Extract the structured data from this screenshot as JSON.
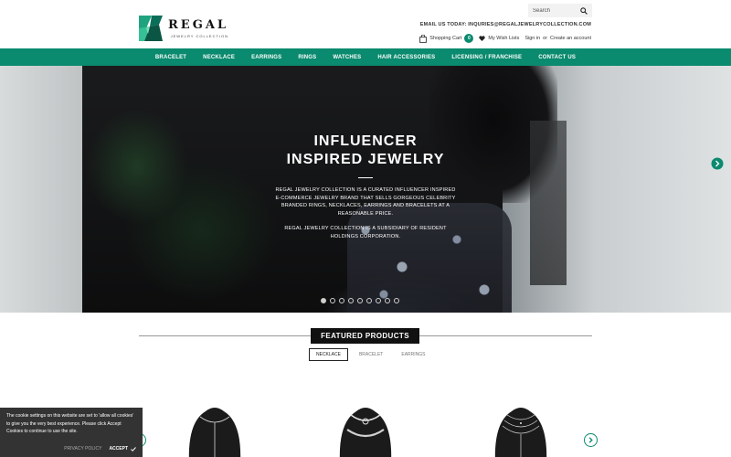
{
  "header": {
    "logo": {
      "name": "REGAL",
      "tagline": "JEWELRY COLLECTION"
    },
    "search": {
      "placeholder": "Search",
      "icon": "search-icon"
    },
    "email_line": "EMAIL US TODAY: INQURIES@REGALJEWELRYCOLLECTION.COM",
    "cart": {
      "label": "Shopping Cart",
      "count": "0",
      "icon": "shopping-bag-icon"
    },
    "wishlist": {
      "label": "My Wish Lists",
      "icon": "heart-icon"
    },
    "signin": "Sign in",
    "or": "or",
    "create_account": "Create an account"
  },
  "nav": {
    "items": [
      "Bracelet",
      "Necklace",
      "Earrings",
      "Rings",
      "Watches",
      "Hair Accessories",
      "Licensing / Franchise",
      "Contact Us"
    ]
  },
  "hero": {
    "title_line1": "INFLUENCER",
    "title_line2": "INSPIRED JEWELRY",
    "text1": "REGAL JEWELRY COLLECTION IS A CURATED INFLUENCER INSPIRED E-COMMERCE JEWELRY BRAND THAT SELLS GORGEOUS CELEBRITY BRANDED RINGS, NECKLACES, EARRINGS AND BRACELETS AT A REASONABLE PRICE.",
    "text2": "REGAL JEWELRY COLLECTION IS A SUBSIDIARY OF RESIDENT HOLDINGS CORPORATION.",
    "slide_count": 9,
    "active_slide": 1,
    "next_icon": "chevron-right-icon"
  },
  "featured": {
    "title": "FEATURED PRODUCTS",
    "tabs": [
      "NECKLACE",
      "BRACELET",
      "EARRINGS"
    ],
    "active_tab": 0
  },
  "cookie": {
    "text": "The cookie settings on this website are set to 'allow all cookies' to give you the very best experience. Please click Accept Cookies to continue to use the site.",
    "policy": "PRIVACY POLICY",
    "accept": "ACCEPT"
  },
  "colors": {
    "brand": "#0a8a6e",
    "dark": "#111111",
    "banner": "#333333"
  }
}
